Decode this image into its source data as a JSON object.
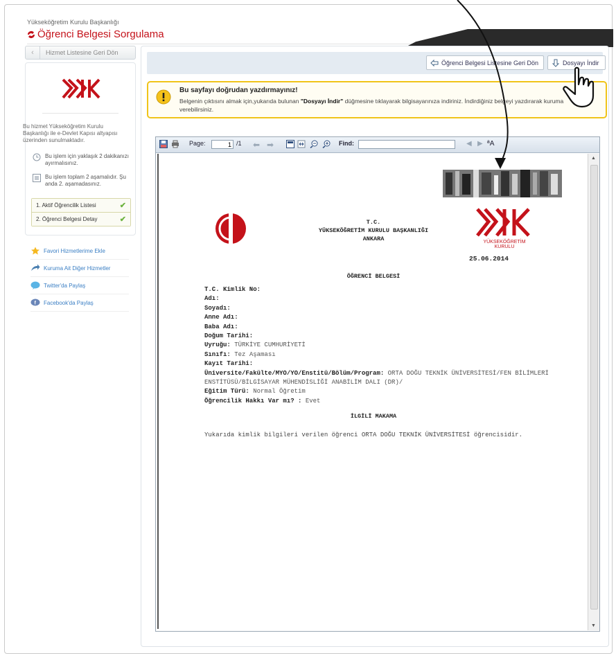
{
  "header": {
    "org_name": "Yükseköğretim Kurulu Başkanlığı",
    "page_title": "Öğrenci Belgesi Sorgulama"
  },
  "sidebar": {
    "back_label": "Hizmet Listesine Geri Dön",
    "description": "Bu hizmet Yükseköğretim Kurulu Başkanlığı ile e-Devlet Kapısı altyapısı üzerinden sunulmaktadır.",
    "time_info": "Bu işlem için yaklaşık 2 dakikanızı ayırmalısınız.",
    "stage_info": "Bu işlem toplam 2 aşamalıdır. Şu anda 2. aşamadasınız.",
    "steps": [
      {
        "label": "1. Aktif Öğrencilik Listesi"
      },
      {
        "label": "2. Öğrenci Belgesi Detay"
      }
    ],
    "links": [
      {
        "label": "Favori Hizmetlerime Ekle",
        "icon": "star-icon"
      },
      {
        "label": "Kuruma Ait Diğer Hizmetler",
        "icon": "share-arrow-icon"
      },
      {
        "label": "Twitter'da Paylaş",
        "icon": "twitter-icon"
      },
      {
        "label": "Facebook'da Paylaş",
        "icon": "facebook-icon"
      }
    ]
  },
  "toolbar": {
    "back_to_list_label": "Öğrenci Belgesi Listesine Geri Dön",
    "download_label": "Dosyayı İndir"
  },
  "warning": {
    "title": "Bu sayfayı doğrudan yazdırmayınız!",
    "text_before": "Belgenin çıktısını almak için,yukarıda bulunan ",
    "text_bold": "\"Dosyayı İndir\"",
    "text_after": " düğmesine tıklayarak bilgisayarınıza indiriniz. İndirdiğiniz belgeyi yazdırarak kuruma verebilirsiniz."
  },
  "viewer": {
    "page_label": "Page:",
    "page_value": "1",
    "page_total": "/1",
    "find_label": "Find:",
    "text_size_glyph": "ªA"
  },
  "document": {
    "header_line1": "T.C.",
    "header_line2": "YÜKSEKÖĞRETİM KURULU BAŞKANLIĞI",
    "header_line3": "ANKARA",
    "yok_caption": "YÜKSEKÖĞRETİM KURULU",
    "date": "25.06.2014",
    "doc_title": "ÖĞRENCİ BELGESİ",
    "fields": [
      {
        "label": "T.C. Kimlik No:",
        "value": ""
      },
      {
        "label": "Adı:",
        "value": ""
      },
      {
        "label": "Soyadı:",
        "value": ""
      },
      {
        "label": "Anne Adı:",
        "value": ""
      },
      {
        "label": "Baba Adı:",
        "value": ""
      },
      {
        "label": "Doğum Tarihi:",
        "value": ""
      },
      {
        "label": "Uyruğu:",
        "value": "TÜRKİYE CUMHURİYETİ"
      },
      {
        "label": "Sınıfı:",
        "value": "Tez Aşaması"
      },
      {
        "label": "Kayıt Tarihi:",
        "value": ""
      },
      {
        "label": "Üniversite/Fakülte/MYO/YO/Enstitü/Bölüm/Program:",
        "value": "ORTA DOĞU TEKNİK ÜNİVERSİTESİ/FEN BİLİMLERİ ENSTİTÜSÜ/BİLGİSAYAR MÜHENDİSLİĞİ ANABİLİM DALI (DR)/"
      },
      {
        "label": "Eğitim Türü:",
        "value": "Normal Öğretim"
      },
      {
        "label": "Öğrencilik Hakkı Var mı? :",
        "value": "Evet"
      }
    ],
    "section_title": "İLGİLİ MAKAMA",
    "body_text": "Yukarıda kimlik bilgileri verilen öğrenci ORTA DOĞU TEKNİK ÜNİVERSİTESİ öğrencisidir."
  },
  "colors": {
    "brand_red": "#c4121a",
    "link_blue": "#3b7fc4",
    "warning_border": "#f0c419",
    "step_check": "#6db33f"
  }
}
